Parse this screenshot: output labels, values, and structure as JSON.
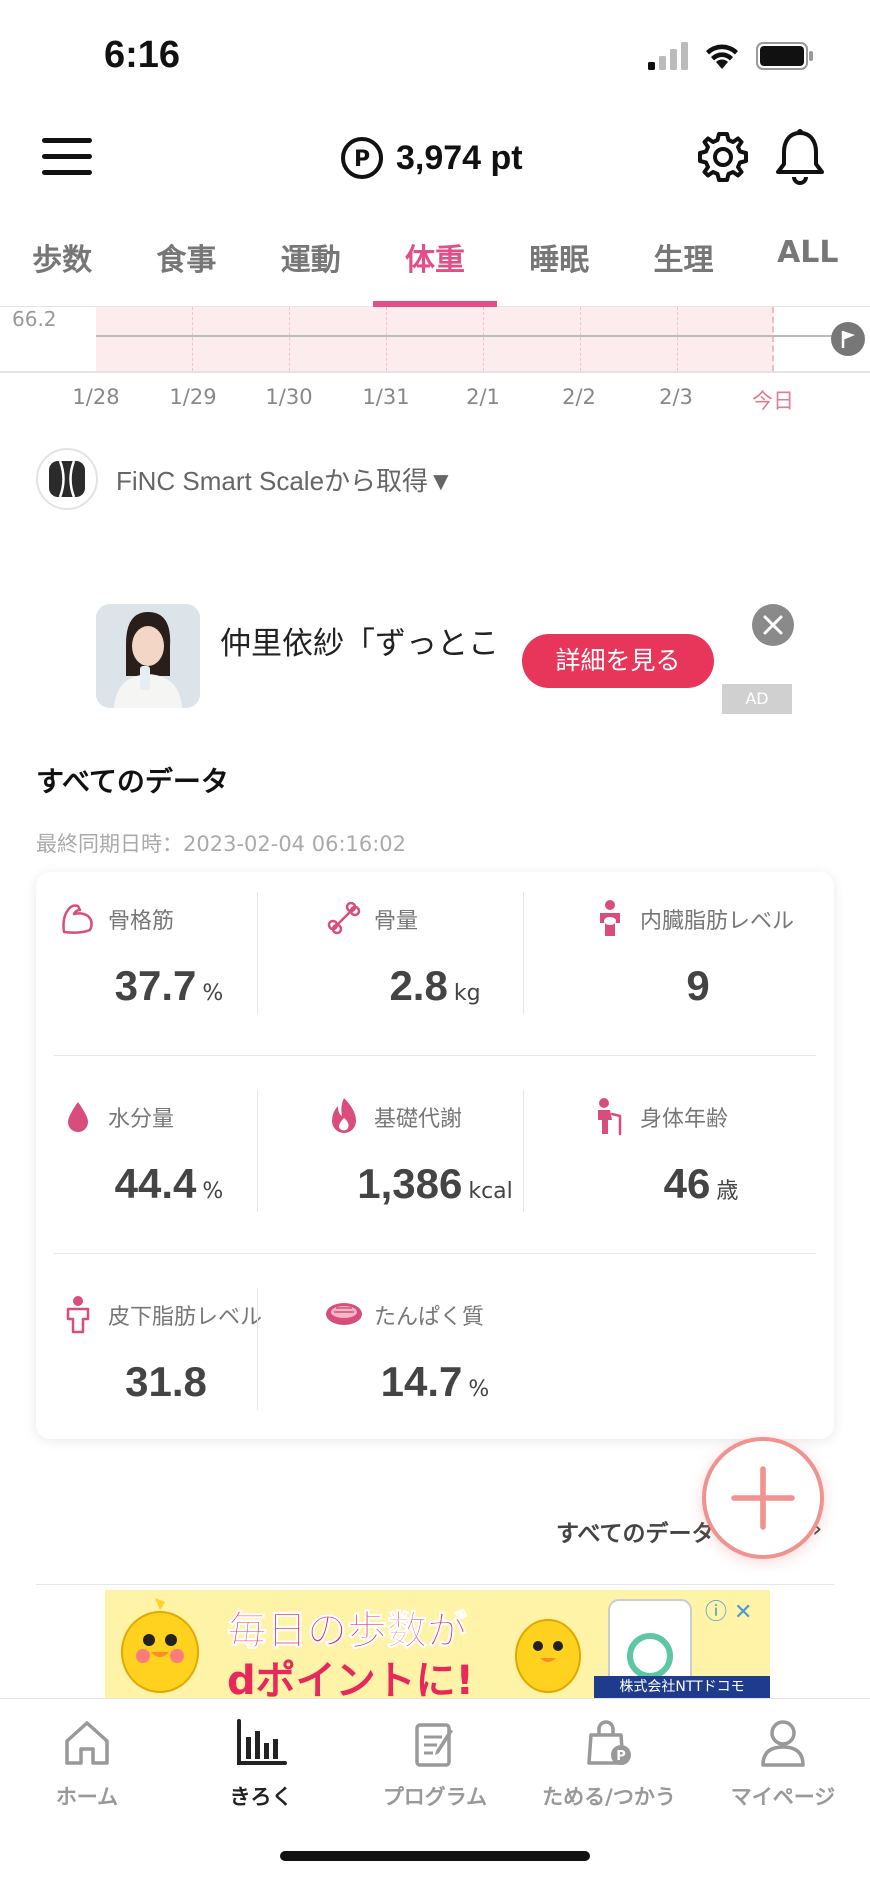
{
  "status_bar": {
    "time": "6:16"
  },
  "header": {
    "points": "3,974 pt"
  },
  "tabs": [
    {
      "label": "歩数",
      "active": false
    },
    {
      "label": "食事",
      "active": false
    },
    {
      "label": "運動",
      "active": false
    },
    {
      "label": "体重",
      "active": true
    },
    {
      "label": "睡眠",
      "active": false
    },
    {
      "label": "生理",
      "active": false
    },
    {
      "label": "ALL",
      "active": false
    }
  ],
  "chart": {
    "y_label": "66.2",
    "x_labels": [
      "1/28",
      "1/29",
      "1/30",
      "1/31",
      "2/1",
      "2/2",
      "2/3",
      "今日"
    ]
  },
  "source": {
    "label": "FiNC Smart Scaleから取得▼"
  },
  "ad": {
    "title": "仲里依紗「ずっとこ",
    "cta": "詳細を見る",
    "badge": "AD"
  },
  "data_section": {
    "title": "すべてのデータ",
    "sync": "最終同期日時：2023-02-04 06:16:02",
    "metrics": [
      {
        "label": "骨格筋",
        "value": "37.7",
        "unit": "%",
        "icon": "muscle-icon"
      },
      {
        "label": "骨量",
        "value": "2.8",
        "unit": "kg",
        "icon": "bone-icon"
      },
      {
        "label": "内臓脂肪レベル",
        "value": "9",
        "unit": "",
        "icon": "visceral-fat-icon"
      },
      {
        "label": "水分量",
        "value": "44.4",
        "unit": "%",
        "icon": "water-drop-icon"
      },
      {
        "label": "基礎代謝",
        "value": "1,386",
        "unit": "kcal",
        "icon": "flame-icon"
      },
      {
        "label": "身体年齢",
        "value": "46",
        "unit": "歳",
        "icon": "body-age-icon"
      },
      {
        "label": "皮下脂肪レベル",
        "value": "31.8",
        "unit": "",
        "icon": "subcutaneous-fat-icon"
      },
      {
        "label": "たんぱく質",
        "value": "14.7",
        "unit": "%",
        "icon": "meat-icon"
      }
    ],
    "more_link": "すべてのデータ"
  },
  "banner": {
    "line1": "毎日の歩数が",
    "line2": "dポイントに!",
    "company": "株式会社NTTドコモ"
  },
  "bottom_nav": [
    {
      "label": "ホーム",
      "active": false
    },
    {
      "label": "きろく",
      "active": true
    },
    {
      "label": "プログラム",
      "active": false
    },
    {
      "label": "ためる/つかう",
      "active": false
    },
    {
      "label": "マイページ",
      "active": false
    }
  ],
  "colors": {
    "accent": "#e04f87",
    "ad_cta": "#e8365a",
    "fab_border": "#f0928f"
  }
}
